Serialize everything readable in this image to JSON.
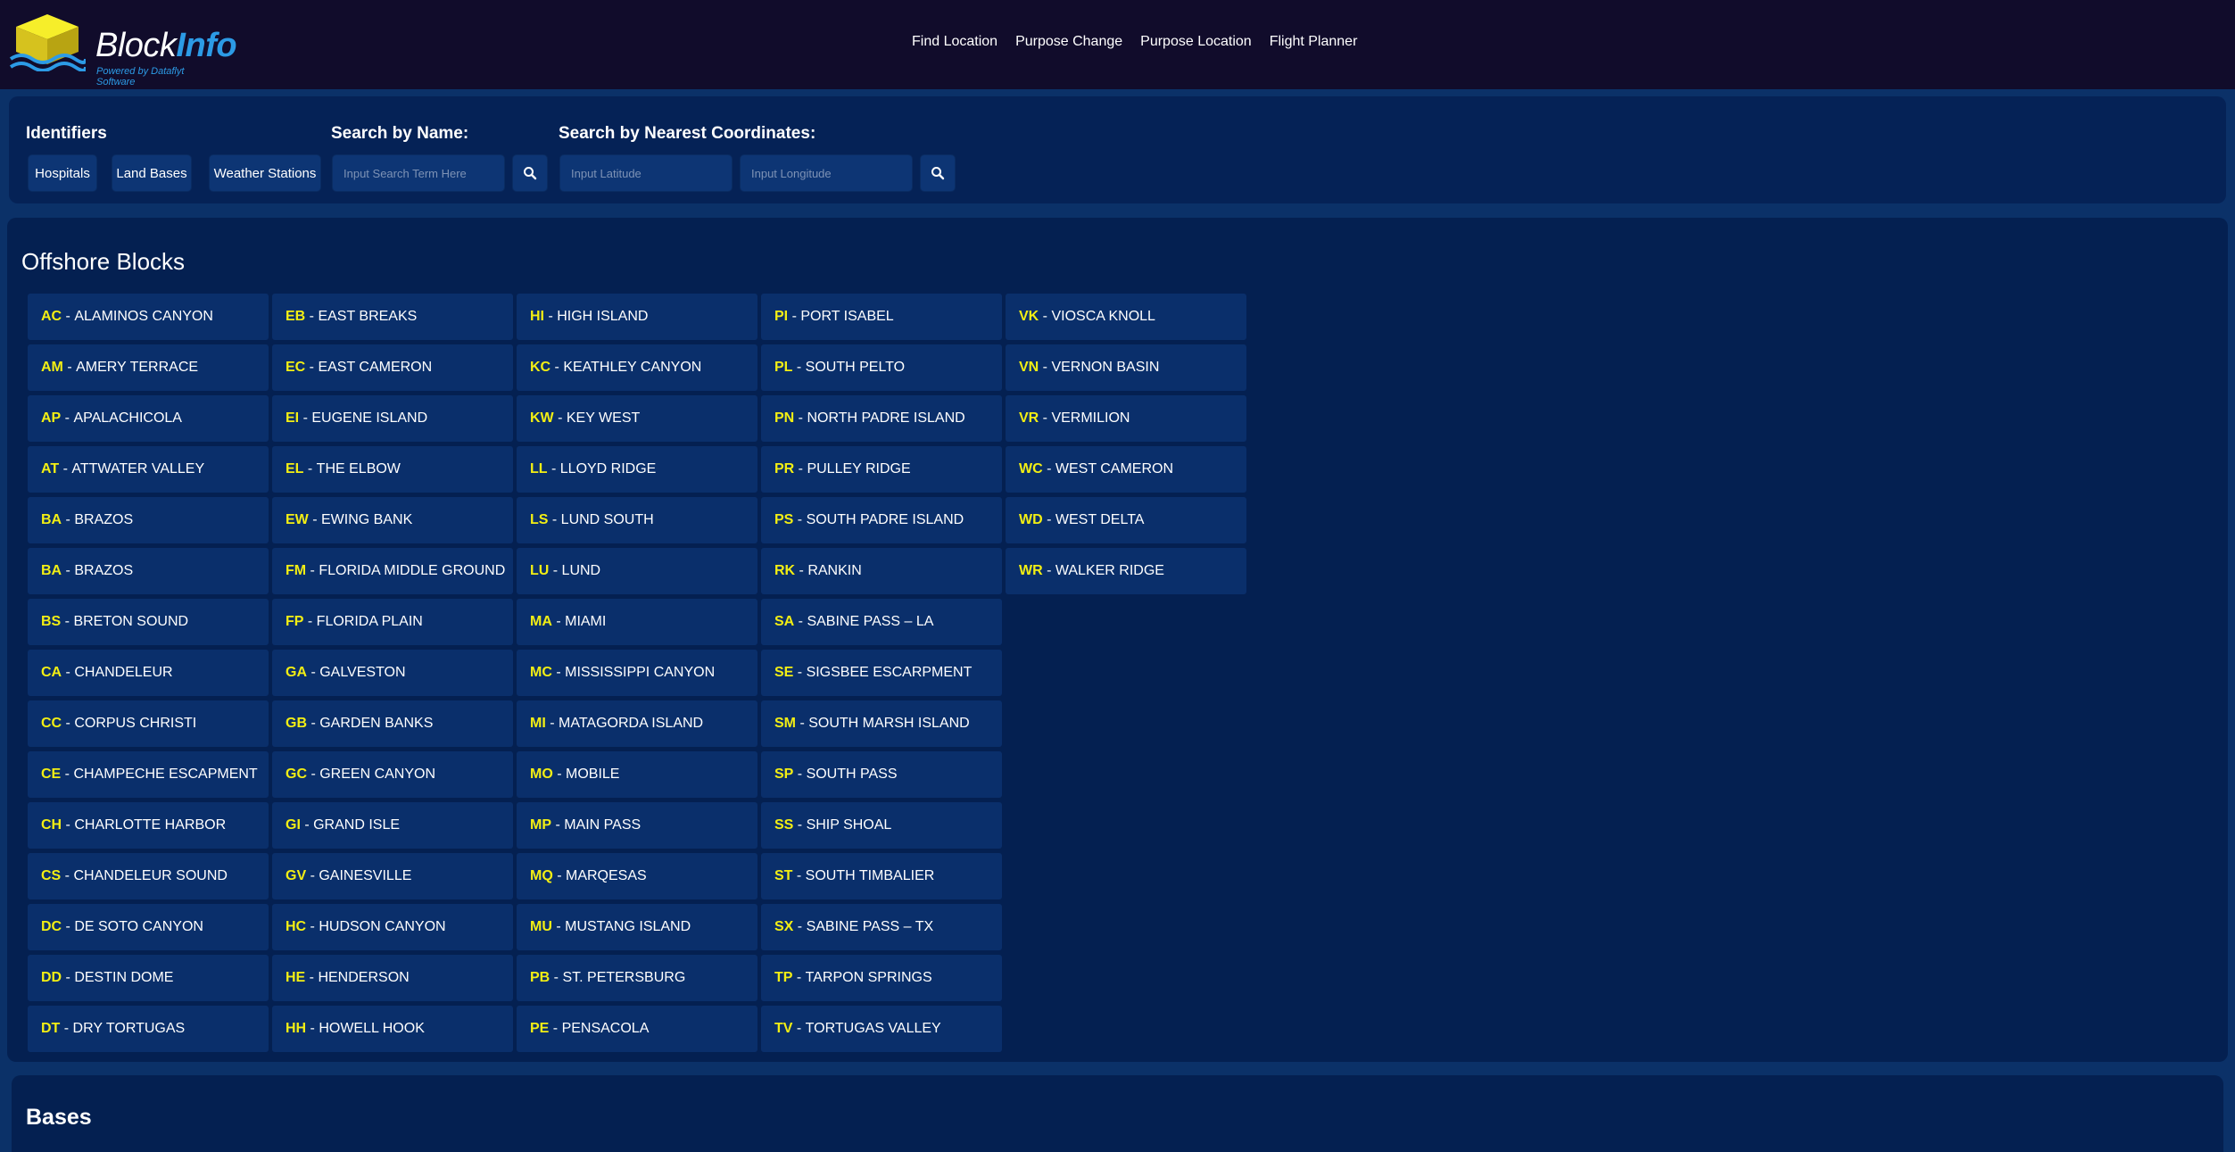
{
  "brand": {
    "name_part1": "Block",
    "name_part2": "Info",
    "tagline": "Powered by Dataflyt Software"
  },
  "nav": [
    {
      "label": "Find Location"
    },
    {
      "label": "Purpose Change"
    },
    {
      "label": "Purpose Location"
    },
    {
      "label": "Flight Planner"
    }
  ],
  "search": {
    "identifiers_title": "Identifiers",
    "identifier_buttons": [
      "Hospitals",
      "Land Bases",
      "Weather Stations"
    ],
    "by_name_title": "Search by Name:",
    "name_placeholder": "Input Search Term Here",
    "by_coords_title": "Search by Nearest Coordinates:",
    "lat_placeholder": "Input Latitude",
    "lon_placeholder": "Input Longitude"
  },
  "offshore_blocks": {
    "title": "Offshore Blocks",
    "items": [
      {
        "code": "AC",
        "name": "ALAMINOS CANYON"
      },
      {
        "code": "AM",
        "name": "AMERY TERRACE"
      },
      {
        "code": "AP",
        "name": "APALACHICOLA"
      },
      {
        "code": "AT",
        "name": "ATTWATER VALLEY"
      },
      {
        "code": "BA",
        "name": "BRAZOS"
      },
      {
        "code": "BA",
        "name": "BRAZOS"
      },
      {
        "code": "BS",
        "name": "BRETON SOUND"
      },
      {
        "code": "CA",
        "name": "CHANDELEUR"
      },
      {
        "code": "CC",
        "name": "CORPUS CHRISTI"
      },
      {
        "code": "CE",
        "name": "CHAMPECHE ESCAPMENT"
      },
      {
        "code": "CH",
        "name": "CHARLOTTE HARBOR"
      },
      {
        "code": "CS",
        "name": "CHANDELEUR SOUND"
      },
      {
        "code": "DC",
        "name": "DE SOTO CANYON"
      },
      {
        "code": "DD",
        "name": "DESTIN DOME"
      },
      {
        "code": "DT",
        "name": "DRY TORTUGAS"
      },
      {
        "code": "EB",
        "name": "EAST BREAKS"
      },
      {
        "code": "EC",
        "name": "EAST CAMERON"
      },
      {
        "code": "EI",
        "name": "EUGENE ISLAND"
      },
      {
        "code": "EL",
        "name": "THE ELBOW"
      },
      {
        "code": "EW",
        "name": "EWING BANK"
      },
      {
        "code": "FM",
        "name": "FLORIDA MIDDLE GROUND"
      },
      {
        "code": "FP",
        "name": "FLORIDA PLAIN"
      },
      {
        "code": "GA",
        "name": "GALVESTON"
      },
      {
        "code": "GB",
        "name": "GARDEN BANKS"
      },
      {
        "code": "GC",
        "name": "GREEN CANYON"
      },
      {
        "code": "GI",
        "name": "GRAND ISLE"
      },
      {
        "code": "GV",
        "name": "GAINESVILLE"
      },
      {
        "code": "HC",
        "name": "HUDSON CANYON"
      },
      {
        "code": "HE",
        "name": "HENDERSON"
      },
      {
        "code": "HH",
        "name": "HOWELL HOOK"
      },
      {
        "code": "HI",
        "name": "HIGH ISLAND"
      },
      {
        "code": "KC",
        "name": "KEATHLEY CANYON"
      },
      {
        "code": "KW",
        "name": "KEY WEST"
      },
      {
        "code": "LL",
        "name": "LLOYD RIDGE"
      },
      {
        "code": "LS",
        "name": "LUND SOUTH"
      },
      {
        "code": "LU",
        "name": "LUND"
      },
      {
        "code": "MA",
        "name": "MIAMI"
      },
      {
        "code": "MC",
        "name": "MISSISSIPPI CANYON"
      },
      {
        "code": "MI",
        "name": "MATAGORDA ISLAND"
      },
      {
        "code": "MO",
        "name": "MOBILE"
      },
      {
        "code": "MP",
        "name": "MAIN PASS"
      },
      {
        "code": "MQ",
        "name": "MARQESAS"
      },
      {
        "code": "MU",
        "name": "MUSTANG ISLAND"
      },
      {
        "code": "PB",
        "name": "ST. PETERSBURG"
      },
      {
        "code": "PE",
        "name": "PENSACOLA"
      },
      {
        "code": "PI",
        "name": "PORT ISABEL"
      },
      {
        "code": "PL",
        "name": "SOUTH PELTO"
      },
      {
        "code": "PN",
        "name": "NORTH PADRE ISLAND"
      },
      {
        "code": "PR",
        "name": "PULLEY RIDGE"
      },
      {
        "code": "PS",
        "name": "SOUTH PADRE ISLAND"
      },
      {
        "code": "RK",
        "name": "RANKIN"
      },
      {
        "code": "SA",
        "name": "SABINE PASS – LA"
      },
      {
        "code": "SE",
        "name": "SIGSBEE ESCARPMENT"
      },
      {
        "code": "SM",
        "name": "SOUTH MARSH ISLAND"
      },
      {
        "code": "SP",
        "name": "SOUTH PASS"
      },
      {
        "code": "SS",
        "name": "SHIP SHOAL"
      },
      {
        "code": "ST",
        "name": "SOUTH TIMBALIER"
      },
      {
        "code": "SX",
        "name": "SABINE PASS – TX"
      },
      {
        "code": "TP",
        "name": "TARPON SPRINGS"
      },
      {
        "code": "TV",
        "name": "TORTUGAS VALLEY"
      },
      {
        "code": "VK",
        "name": "VIOSCA KNOLL"
      },
      {
        "code": "VN",
        "name": "VERNON BASIN"
      },
      {
        "code": "VR",
        "name": "VERMILION"
      },
      {
        "code": "WC",
        "name": "WEST CAMERON"
      },
      {
        "code": "WD",
        "name": "WEST DELTA"
      },
      {
        "code": "WR",
        "name": "WALKER RIDGE"
      }
    ]
  },
  "bases": {
    "title": "Bases"
  },
  "colors": {
    "code_highlight": "#f2ee14",
    "brand_accent": "#2c9be6",
    "header_bg": "#110c2b",
    "page_bg": "#0b3168"
  }
}
